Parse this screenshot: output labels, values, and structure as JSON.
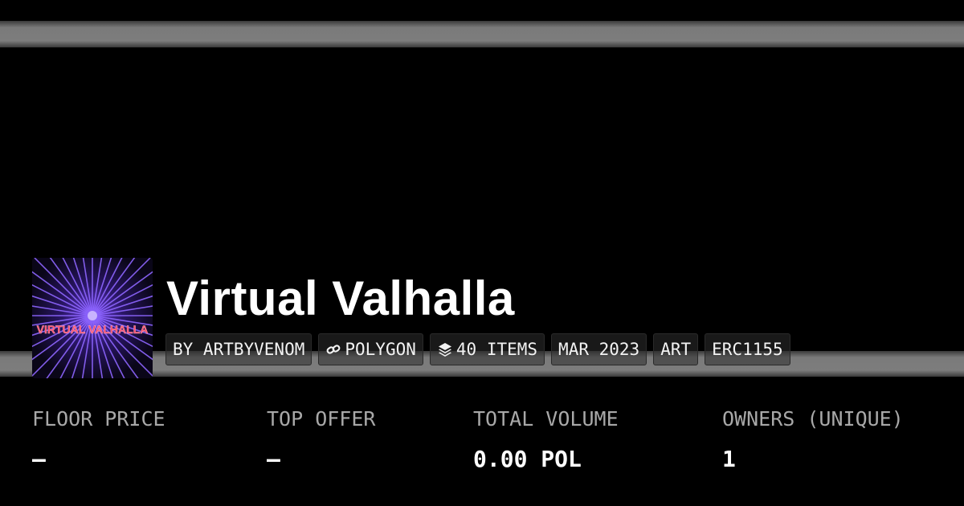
{
  "collection": {
    "name": "Virtual Valhalla",
    "logo_text": "VIRTUAL VALHALLA",
    "tags": {
      "creator": "BY ARTBYVENOM",
      "chain": "POLYGON",
      "items": "40 ITEMS",
      "date": "MAR 2023",
      "category": "ART",
      "standard": "ERC1155"
    },
    "icons": {
      "chain": "link-icon",
      "items": "layers-icon"
    }
  },
  "stats": {
    "floor_price": {
      "label": "FLOOR PRICE",
      "value": "–"
    },
    "top_offer": {
      "label": "TOP OFFER",
      "value": "–"
    },
    "total_volume": {
      "label": "TOTAL VOLUME",
      "value": "0.00 POL"
    },
    "owners": {
      "label": "OWNERS (UNIQUE)",
      "value": "1"
    }
  },
  "colors": {
    "background": "#000000",
    "stripe": "#7a7a7a",
    "logo_purple": "#8a5cff",
    "logo_text": "#ff4d6d",
    "label_gray": "#a8a8a8"
  }
}
